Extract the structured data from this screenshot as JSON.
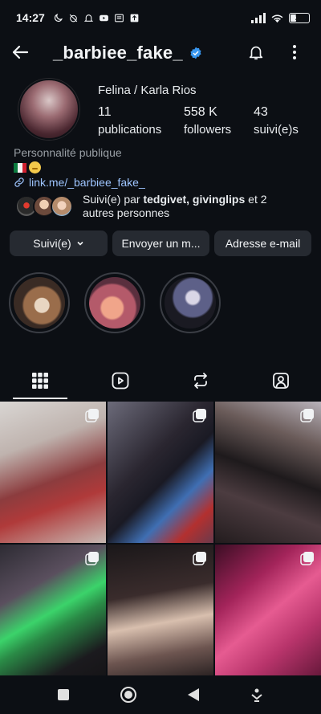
{
  "status_bar": {
    "time": "14:27",
    "battery": "29",
    "battery_level": 0.29
  },
  "header": {
    "username": "_barbiee_fake_",
    "verified": true
  },
  "profile": {
    "display_name": "Felina / Karla Rios",
    "stats": [
      {
        "value": "11",
        "label": "publications"
      },
      {
        "value": "558 K",
        "label": "followers"
      },
      {
        "value": "43",
        "label": "suivi(e)s"
      }
    ],
    "category": "Personnalité publique",
    "link": "link.me/_barbiee_fake_",
    "followed_by_prefix": "Suivi(e) par ",
    "followed_by_names": "tedgivet, givinglips",
    "followed_by_suffix": " et 2 autres personnes"
  },
  "buttons": {
    "follow": "Suivi(e)",
    "message": "Envoyer un m...",
    "email": "Adresse e-mail"
  },
  "highlights": [
    "highlight-1",
    "highlight-2",
    "highlight-3"
  ],
  "tabs": [
    {
      "icon": "grid-icon",
      "active": true
    },
    {
      "icon": "reels-icon",
      "active": false
    },
    {
      "icon": "reposts-icon",
      "active": false
    },
    {
      "icon": "tagged-icon",
      "active": false
    }
  ],
  "colors": {
    "background": "#0c0f14",
    "button": "#262a31",
    "link": "#9ec5ff",
    "verified": "#3897f0"
  }
}
